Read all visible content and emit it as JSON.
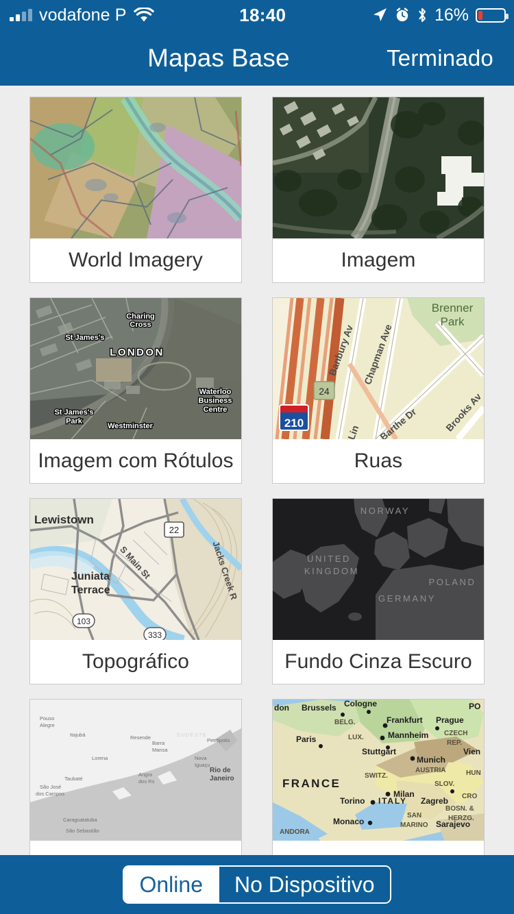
{
  "status_bar": {
    "carrier": "vodafone P",
    "time": "18:40",
    "battery_percent": "16%",
    "icons": [
      "signal-bars-icon",
      "wifi-icon",
      "location-arrow-icon",
      "alarm-clock-icon",
      "bluetooth-icon",
      "battery-icon"
    ]
  },
  "nav_bar": {
    "title": "Mapas Base",
    "done_label": "Terminado"
  },
  "colors": {
    "brand_blue": "#0e5f99",
    "page_background": "#ededed",
    "card_background": "#ffffff",
    "card_border": "#c9c9c9",
    "label_text": "#333333",
    "battery_low": "#f13c2b"
  },
  "basemaps": [
    {
      "label": "World Imagery",
      "thumb_kind": "landcover-pastel",
      "thumb_labels": []
    },
    {
      "label": "Imagem",
      "thumb_kind": "satellite-dark",
      "thumb_labels": []
    },
    {
      "label": "Imagem com Rótulos",
      "thumb_kind": "satellite-labels-london",
      "thumb_labels": [
        "Charing Cross",
        "St James's",
        "LONDON",
        "Waterloo Business Centre",
        "St James's Park",
        "Westminster"
      ]
    },
    {
      "label": "Ruas",
      "thumb_kind": "streets",
      "thumb_labels": [
        "Banbury Ave",
        "Chapman Ave",
        "Brenner Park",
        "Barthe Dr",
        "Brooks Ave",
        "Lin",
        "24",
        "210"
      ]
    },
    {
      "label": "Topográfico",
      "thumb_kind": "topographic",
      "thumb_labels": [
        "Lewistown",
        "Juniata Terrace",
        "S Main St",
        "Jacks Creek",
        "22",
        "103",
        "333"
      ]
    },
    {
      "label": "Fundo Cinza Escuro",
      "thumb_kind": "dark-gray-canvas",
      "thumb_labels": [
        "NORWAY",
        "UNITED KINGDOM",
        "POLAND",
        "GERMANY"
      ]
    },
    {
      "label": "",
      "thumb_kind": "light-gray-canvas",
      "thumb_labels": [
        "Pouso Alegre",
        "Itajubá",
        "Resende",
        "Barra Mansa",
        "Petrópolis",
        "Lorena",
        "Nova Iguaçu",
        "Rio de Janeiro",
        "Taubaté",
        "Angra dos Reis",
        "São José dos Campos",
        "Caraguatatuba",
        "São Sebastião"
      ]
    },
    {
      "label": "",
      "thumb_kind": "terrain-europe",
      "thumb_labels": [
        "don",
        "Brussels",
        "Cologne",
        "PO",
        "BELG.",
        "Frankfurt",
        "Prague",
        "Paris",
        "LUX.",
        "Mannheim",
        "CZECH REP.",
        "Stuttgart",
        "Vien",
        "Munich",
        "AUSTRIA",
        "FRANCE",
        "SWITZ.",
        "HUN",
        "SLOV.",
        "Milan",
        "Zagreb",
        "CRO",
        "Torino",
        "ITALY",
        "BOSN. &",
        "HERZG.",
        "Monaco",
        "SAN MARINO",
        "Sarajevo",
        "ANDORA"
      ]
    }
  ],
  "bottom_toolbar": {
    "segments": [
      {
        "label": "Online",
        "selected": true
      },
      {
        "label": "No Dispositivo",
        "selected": false
      }
    ]
  }
}
